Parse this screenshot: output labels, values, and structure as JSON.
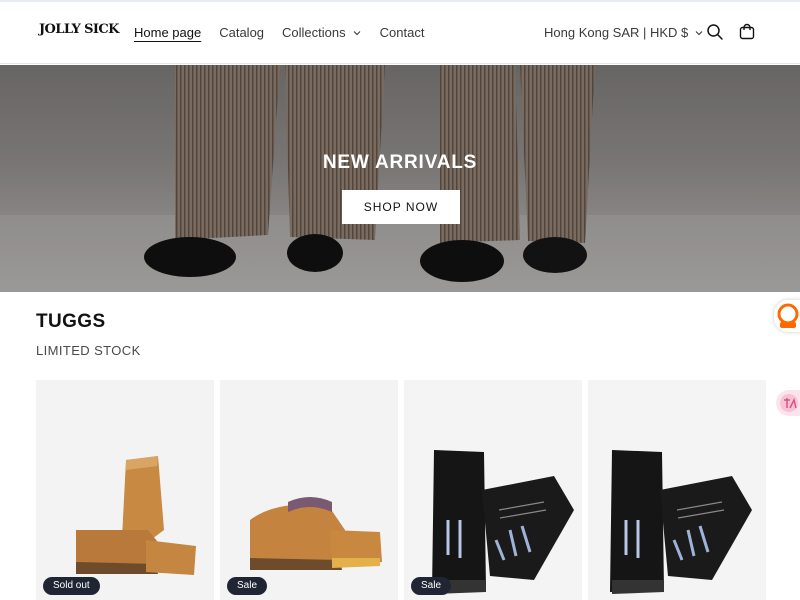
{
  "header": {
    "logo": "JOLLY SICK",
    "nav": [
      {
        "label": "Home page",
        "active": true
      },
      {
        "label": "Catalog",
        "active": false
      },
      {
        "label": "Collections",
        "active": false,
        "dropdown": true
      },
      {
        "label": "Contact",
        "active": false
      }
    ],
    "currency": "Hong Kong SAR | HKD $",
    "icons": [
      "search-icon",
      "cart-icon"
    ]
  },
  "hero": {
    "title": "NEW ARRIVALS",
    "button_label": "SHOP NOW"
  },
  "section": {
    "title": "TUGGS",
    "subtitle": "LIMITED STOCK"
  },
  "products": [
    {
      "badge": "Sold out",
      "image": "tan suede ankle boot"
    },
    {
      "badge": "Sale",
      "image": "tan suede slipper"
    },
    {
      "badge": "Sale",
      "image": "black leather shoes with painted text"
    },
    {
      "badge": "",
      "image": "black leather shoes with painted text"
    }
  ],
  "colors": {
    "badge_bg": "#1f2533",
    "hero_text": "#ffffff",
    "accent_widget": "#ff6a00"
  }
}
